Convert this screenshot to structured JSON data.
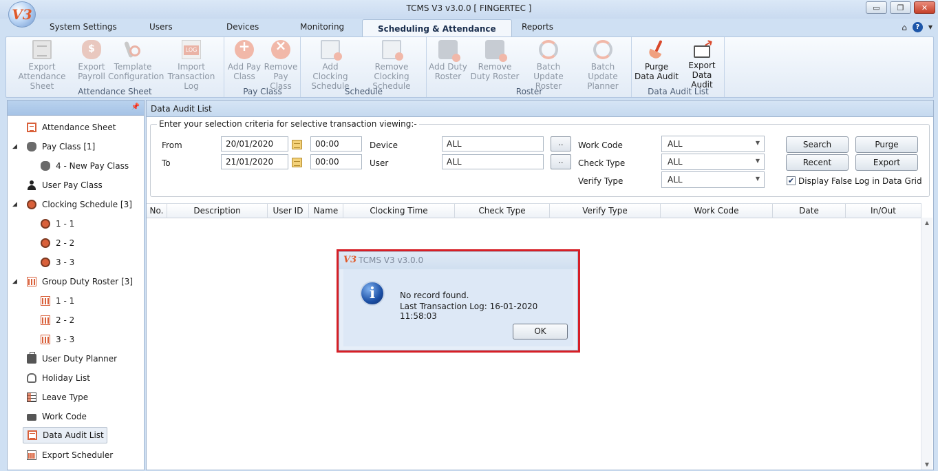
{
  "window": {
    "title": "TCMS V3 v3.0.0 [ FINGERTEC ]",
    "logo": "V3",
    "controls": [
      "minimize-icon",
      "restore-icon",
      "close-icon"
    ]
  },
  "tabs": [
    {
      "label": "System Settings"
    },
    {
      "label": "Users"
    },
    {
      "label": "Devices"
    },
    {
      "label": "Monitoring"
    },
    {
      "label": "Scheduling & Attendance",
      "active": true
    },
    {
      "label": "Reports"
    }
  ],
  "ribbon": {
    "groups": [
      {
        "label": "Attendance Sheet",
        "buttons": [
          {
            "label": "Export Attendance Sheet",
            "icon": "sheet-icon",
            "enabled": false
          },
          {
            "label": "Export Payroll",
            "icon": "money-bag-icon",
            "enabled": false
          },
          {
            "label": "Template Configuration",
            "icon": "wrench-gear-icon",
            "enabled": false
          },
          {
            "label": "Import Transaction Log",
            "icon": "log-icon",
            "enabled": false
          }
        ]
      },
      {
        "label": "Pay Class",
        "buttons": [
          {
            "label": "Add Pay Class",
            "icon": "add-icon",
            "enabled": false
          },
          {
            "label": "Remove Pay Class",
            "icon": "remove-icon",
            "enabled": false
          }
        ]
      },
      {
        "label": "Schedule",
        "buttons": [
          {
            "label": "Add Clocking Schedule",
            "icon": "add-schedule-icon",
            "enabled": false
          },
          {
            "label": "Remove Clocking Schedule",
            "icon": "remove-schedule-icon",
            "enabled": false
          }
        ]
      },
      {
        "label": "Roster",
        "buttons": [
          {
            "label": "Add Duty Roster",
            "icon": "add-roster-icon",
            "enabled": false
          },
          {
            "label": "Remove Duty Roster",
            "icon": "remove-roster-icon",
            "enabled": false
          },
          {
            "label": "Batch Update Roster",
            "icon": "refresh-icon",
            "enabled": false
          },
          {
            "label": "Batch Update Planner",
            "icon": "refresh-icon",
            "enabled": false
          }
        ]
      },
      {
        "label": "Data Audit List",
        "buttons": [
          {
            "label": "Purge Data Audit",
            "icon": "broom-icon",
            "enabled": true
          },
          {
            "label": "Export Data Audit",
            "icon": "export-icon",
            "enabled": true
          }
        ]
      }
    ]
  },
  "tree": {
    "items": [
      {
        "label": "Attendance Sheet",
        "icon": "sheet-icon"
      },
      {
        "label": "Pay Class [1]",
        "icon": "money-bag-icon",
        "expanded": true
      },
      {
        "label": "4 - New Pay Class",
        "icon": "money-bag-icon"
      },
      {
        "label": "User Pay Class",
        "icon": "user-icon"
      },
      {
        "label": "Clocking Schedule [3]",
        "icon": "clock-icon",
        "expanded": true
      },
      {
        "label": "1 - 1",
        "icon": "clock-icon"
      },
      {
        "label": "2 - 2",
        "icon": "clock-icon"
      },
      {
        "label": "3 - 3",
        "icon": "clock-icon"
      },
      {
        "label": "Group Duty Roster [3]",
        "icon": "roster-icon",
        "expanded": true
      },
      {
        "label": "1 - 1",
        "icon": "roster-icon"
      },
      {
        "label": "2 - 2",
        "icon": "roster-icon"
      },
      {
        "label": "3 - 3",
        "icon": "roster-icon"
      },
      {
        "label": "User Duty Planner",
        "icon": "briefcase-icon"
      },
      {
        "label": "Holiday List",
        "icon": "slippers-icon"
      },
      {
        "label": "Leave Type",
        "icon": "grid-icon"
      },
      {
        "label": "Work Code",
        "icon": "comment-icon"
      },
      {
        "label": "Data Audit List",
        "icon": "list-icon",
        "selected": true
      },
      {
        "label": "Export Scheduler",
        "icon": "scheduler-icon"
      }
    ]
  },
  "main": {
    "title": "Data Audit List",
    "criteria_legend": "Enter your selection criteria for selective transaction viewing:-",
    "from_label": "From",
    "to_label": "To",
    "from_date": "20/01/2020",
    "to_date": "21/01/2020",
    "from_time": "00:00",
    "to_time": "00:00",
    "device_label": "Device",
    "user_label": "User",
    "device_value": "ALL",
    "user_value": "ALL",
    "ellipsis": "..",
    "work_code_label": "Work Code",
    "check_type_label": "Check Type",
    "verify_type_label": "Verify Type",
    "work_code_value": "ALL",
    "check_type_value": "ALL",
    "verify_type_value": "ALL",
    "search_label": "Search",
    "purge_label": "Purge",
    "recent_label": "Recent",
    "export_label": "Export",
    "display_false_log_label": "Display False Log in Data Grid",
    "display_false_log_checked": true,
    "columns": [
      "No.",
      "Description",
      "User ID",
      "Name",
      "Clocking Time",
      "Check Type",
      "Verify Type",
      "Work Code",
      "Date",
      "In/Out"
    ]
  },
  "dialog": {
    "title": "TCMS V3 v3.0.0",
    "logo": "V3",
    "message": "No record found.",
    "detail": "Last Transaction Log: 16-01-2020 11:58:03",
    "ok_label": "OK"
  },
  "colors": {
    "highlight_border": "#d61f26",
    "ribbon_disabled_text": "#8c96a3",
    "accent": "#1d56a8"
  }
}
